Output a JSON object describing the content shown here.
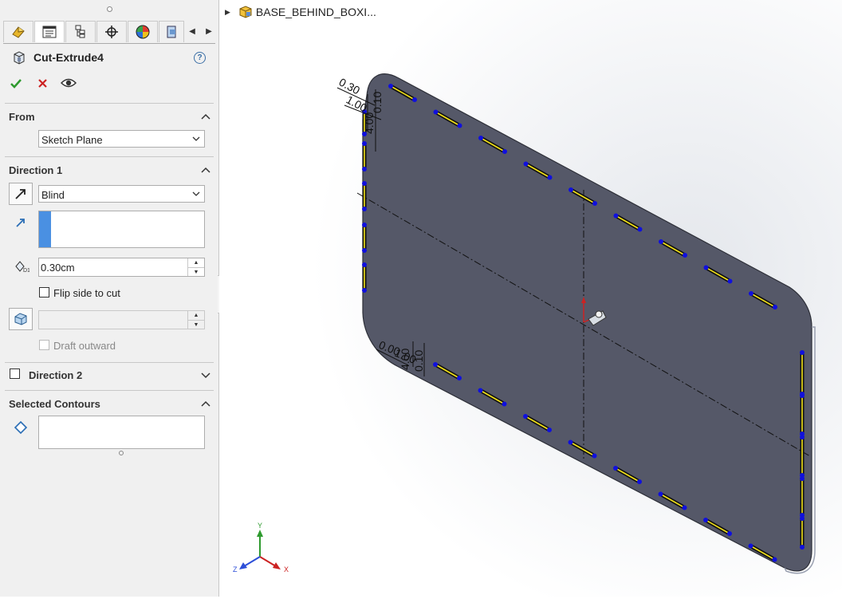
{
  "property_manager": {
    "tabs": [
      {
        "name": "feature-manager-icon"
      },
      {
        "name": "property-manager-icon"
      },
      {
        "name": "configuration-manager-icon"
      },
      {
        "name": "dimxpert-icon"
      },
      {
        "name": "display-manager-icon"
      },
      {
        "name": "extra-tab-icon"
      }
    ],
    "feature_title": "Cut-Extrude4",
    "help_glyph": "?",
    "from": {
      "header": "From",
      "start_condition": "Sketch Plane"
    },
    "direction1": {
      "header": "Direction 1",
      "end_condition": "Blind",
      "depth": "0.30cm",
      "flip_side_label": "Flip side to cut",
      "draft_value": "",
      "draft_outward_label": "Draft outward"
    },
    "direction2": {
      "header": "Direction 2"
    },
    "selected_contours": {
      "header": "Selected Contours"
    }
  },
  "tree": {
    "part_name": "BASE_BEHIND_BOXI..."
  },
  "viewport": {
    "dimensions": {
      "top_left": [
        "0.30",
        "1.00",
        "4.00",
        "0.10"
      ],
      "bottom_left": [
        "0.00",
        "1.00",
        "4.00",
        "0.10"
      ]
    },
    "triad": {
      "x": "X",
      "y": "Y",
      "z": "Z"
    }
  },
  "colors": {
    "plate": "#555868",
    "slot_fill": "#f2e21a",
    "slot_outline": "#111111",
    "sketch_point": "#1010dd",
    "accept": "#2e9a2e",
    "cancel": "#cc2222",
    "accent_blue": "#4a90e2"
  }
}
